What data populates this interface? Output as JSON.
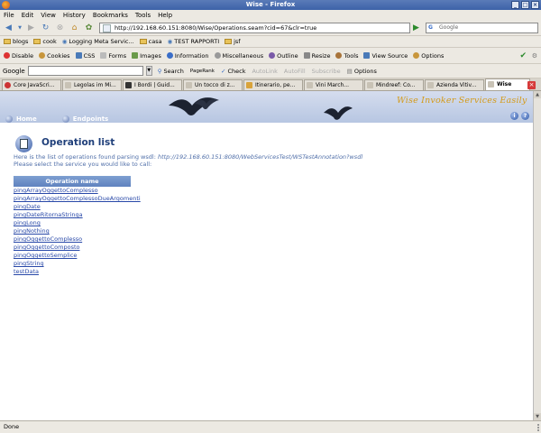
{
  "window": {
    "title": "Wise - Firefox"
  },
  "menu": [
    "File",
    "Edit",
    "View",
    "History",
    "Bookmarks",
    "Tools",
    "Help"
  ],
  "nav": {
    "url": "http://192.168.60.151:8080/Wise/Operations.seam?cid=67&clr=true",
    "search_engine": "G",
    "search_placeholder": "Google"
  },
  "bookmarks": [
    "blogs",
    "cook",
    "Logging Meta Servic...",
    "casa",
    "TEST RAPPORTI",
    "jsf"
  ],
  "dev_toolbar": [
    "Disable",
    "Cookies",
    "CSS",
    "Forms",
    "Images",
    "Information",
    "Miscellaneous",
    "Outline",
    "Resize",
    "Tools",
    "View Source",
    "Options"
  ],
  "google_toolbar": {
    "label": "Google",
    "items": [
      "Search",
      "PageRank",
      "Check",
      "AutoLink",
      "AutoFill",
      "Subscribe",
      "Options"
    ]
  },
  "tabs": [
    {
      "label": "Core JavaScri..."
    },
    {
      "label": "Legolas im Mi..."
    },
    {
      "label": "I Bordi | Guid..."
    },
    {
      "label": "Un tocco di z..."
    },
    {
      "label": "Itinerario, pe..."
    },
    {
      "label": "Vini March..."
    },
    {
      "label": "Mindreef: Co..."
    },
    {
      "label": "Azienda Vitiv..."
    },
    {
      "label": "Wise"
    }
  ],
  "banner": {
    "logo": "Wise Invoker Services Easily",
    "nav": [
      "Home",
      "Endpoints"
    ]
  },
  "page": {
    "title": "Operation list",
    "desc_prefix": "Here is the list of operations found parsing wsdl:",
    "wsdl_url": "http://192.168.60.151:8080/WebServicesTest/WSTestAnnotation?wsdl",
    "desc_line2": "Please select the service you would like to call:",
    "table_header": "Operation name",
    "operations": [
      "pingArrayOggettoComplesso",
      "pingArrayOggettoComplessoDueArgomenti",
      "pingDate",
      "pingDateRitornaStringa",
      "pingLong",
      "pingNothing",
      "pingOggettoComplesso",
      "pingOggettoComposto",
      "pingOggettoSemplice",
      "pingString",
      "testData"
    ]
  },
  "status": {
    "text": "Done"
  }
}
